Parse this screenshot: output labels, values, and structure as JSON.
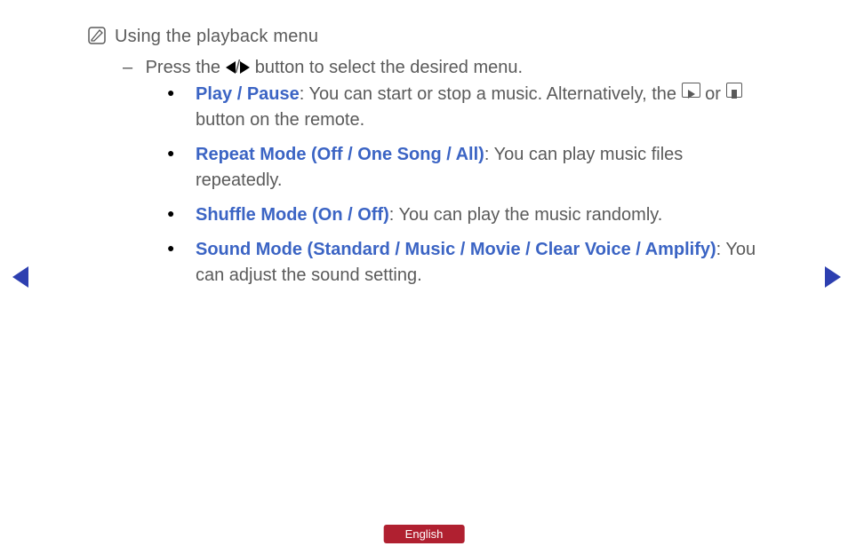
{
  "title": "Using the playback menu",
  "instruction_prefix": "Press the ",
  "instruction_suffix": " button to select the desired menu.",
  "bullets": [
    {
      "label": "Play / Pause",
      "desc_before": ": You can start or stop a music. Alternatively, the ",
      "desc_middle": " or ",
      "desc_after": " button on the remote."
    },
    {
      "label": "Repeat Mode (Off / One Song / All)",
      "desc": ": You can play music files repeatedly."
    },
    {
      "label": "Shuffle Mode (On / Off)",
      "desc": ": You can play the music randomly."
    },
    {
      "label": "Sound Mode (Standard / Music / Movie / Clear Voice / Amplify)",
      "desc": ": You can adjust the sound setting."
    }
  ],
  "language": "English"
}
